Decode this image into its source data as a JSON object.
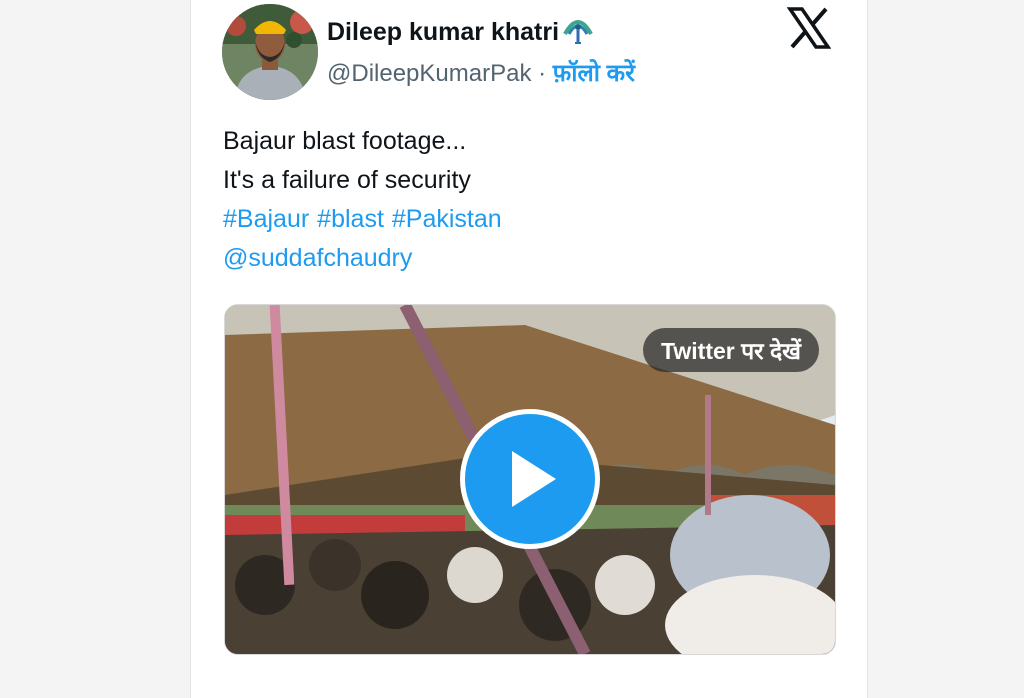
{
  "author": {
    "display_name": "Dileep kumar khatri",
    "handle": "@DileepKumarPak",
    "separator": " · ",
    "follow_label": "फ़ॉलो करें",
    "avatar_icon": "user-avatar-icon",
    "badge_icon": "peacock-emoji-icon"
  },
  "header": {
    "logo_icon": "x-logo-icon"
  },
  "tweet": {
    "line1": "Bajaur blast footage...",
    "line2": "It's a failure of security",
    "hashtags": [
      "#Bajaur",
      "#blast",
      "#Pakistan"
    ],
    "mention": "@suddafchaudry"
  },
  "media": {
    "watch_label": "Twitter पर देखें",
    "play_icon": "play-icon"
  },
  "meta": {
    "timestamp": ""
  },
  "colors": {
    "link": "#1d9bf0",
    "text": "#0f1419",
    "secondary": "#536471"
  }
}
